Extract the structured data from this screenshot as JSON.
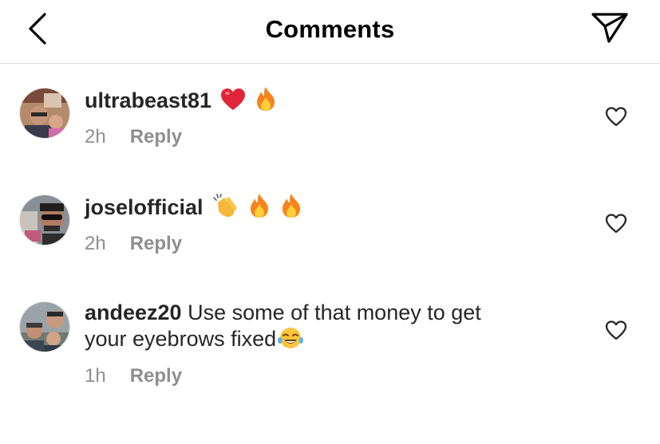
{
  "header": {
    "title": "Comments",
    "back_icon": "chevron-left-icon",
    "share_icon": "paper-plane-icon"
  },
  "comments": [
    {
      "username": "ultrabeast81",
      "text": "",
      "emojis": [
        "heart",
        "fire"
      ],
      "time": "2h",
      "reply_label": "Reply"
    },
    {
      "username": "joselofficial",
      "text": "",
      "emojis": [
        "clapping-hands",
        "fire",
        "fire"
      ],
      "time": "2h",
      "reply_label": "Reply"
    },
    {
      "username": "andeez20",
      "text": "Use some of  that money to get",
      "text_line2": "your eyebrows fixed",
      "emojis": [
        "tears-of-joy"
      ],
      "time": "1h",
      "reply_label": "Reply"
    }
  ],
  "colors": {
    "text": "#262626",
    "muted": "#8e8e8e",
    "divider": "#dbdbdb",
    "heart_red": "#e0243a",
    "fire_orange": "#f5841f"
  }
}
